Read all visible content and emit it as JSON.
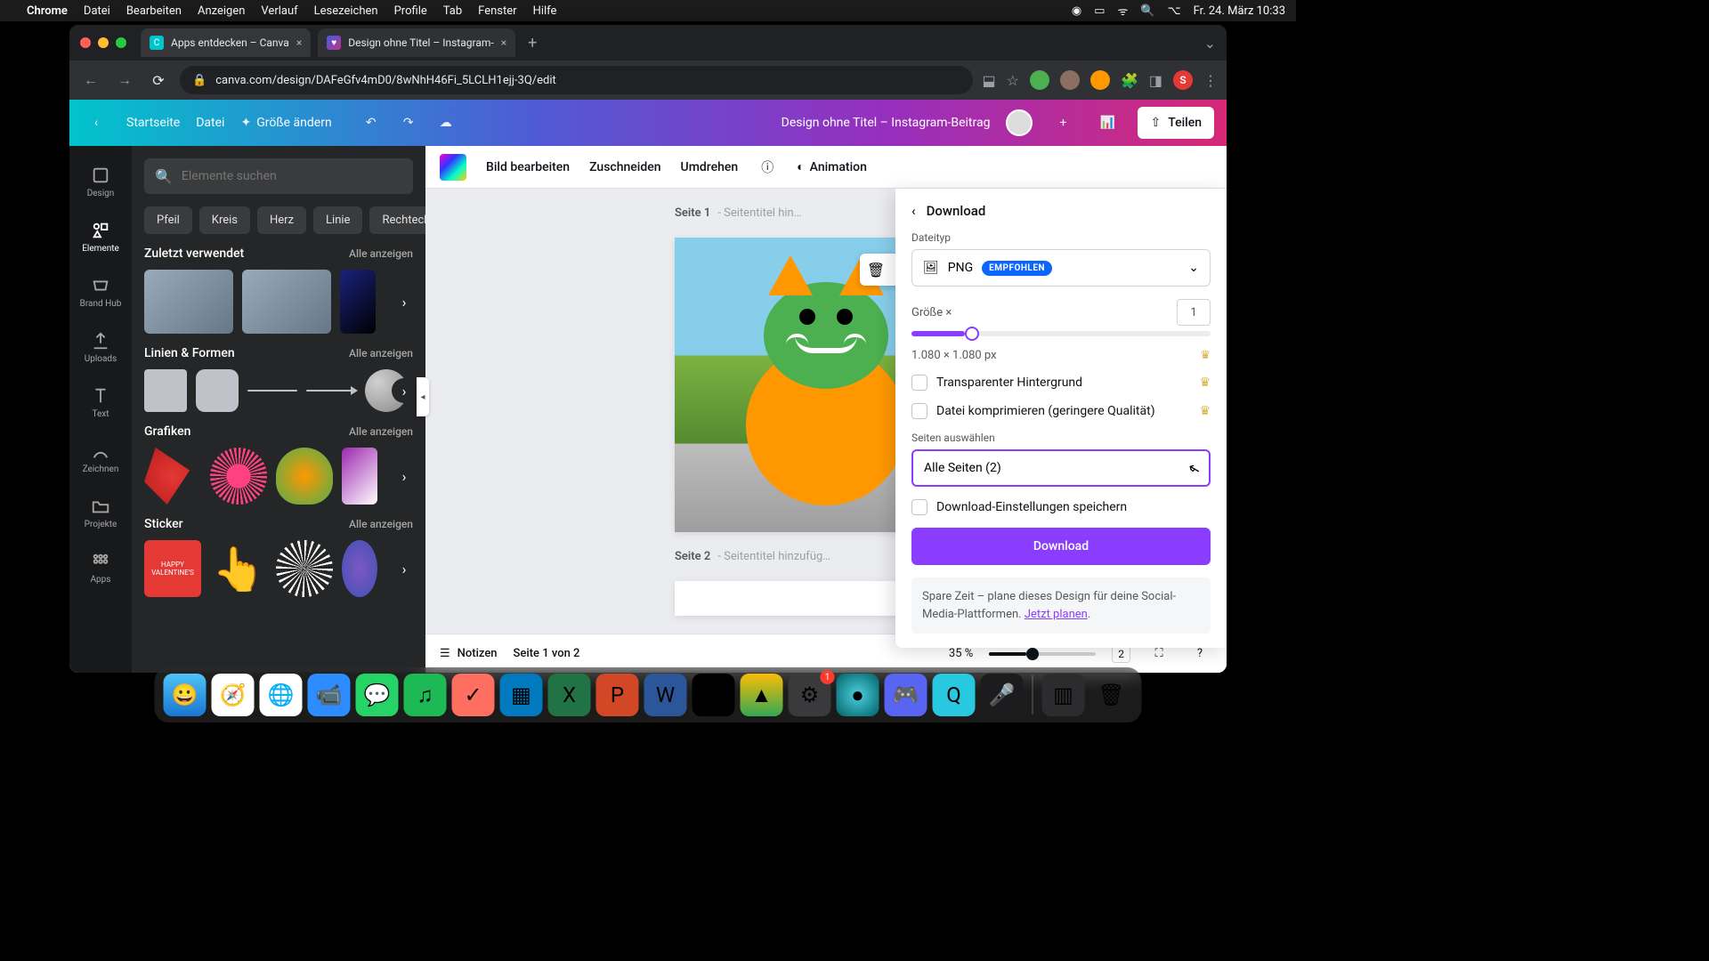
{
  "menubar": {
    "app": "Chrome",
    "items": [
      "Datei",
      "Bearbeiten",
      "Anzeigen",
      "Verlauf",
      "Lesezeichen",
      "Profile",
      "Tab",
      "Fenster",
      "Hilfe"
    ],
    "datetime": "Fr. 24. März  10:33"
  },
  "tabs": {
    "t1": "Apps entdecken – Canva",
    "t2": "Design ohne Titel – Instagram-"
  },
  "url": "canva.com/design/DAFeGfv4mD0/8wNhH46Fi_5LCLH1ejj-3Q/edit",
  "canva_top": {
    "home": "Startseite",
    "file": "Datei",
    "resize": "Größe ändern",
    "docname": "Design ohne Titel – Instagram-Beitrag",
    "share": "Teilen"
  },
  "rail": {
    "design": "Design",
    "elements": "Elemente",
    "brandhub": "Brand Hub",
    "uploads": "Uploads",
    "text": "Text",
    "draw": "Zeichnen",
    "projects": "Projekte",
    "apps": "Apps"
  },
  "panel": {
    "search_placeholder": "Elemente suchen",
    "chips": {
      "c1": "Pfeil",
      "c2": "Kreis",
      "c3": "Herz",
      "c4": "Linie",
      "c5": "Rechteck"
    },
    "s_recent": "Zuletzt verwendet",
    "s_lines": "Linien & Formen",
    "s_graphics": "Grafiken",
    "s_sticker": "Sticker",
    "see_all": "Alle anzeigen"
  },
  "context": {
    "edit_image": "Bild bearbeiten",
    "crop": "Zuschneiden",
    "flip": "Umdrehen",
    "animation": "Animation"
  },
  "pages": {
    "p1_prefix": "Seite 1",
    "p1_rest": " - Seitentitel hin…",
    "p2_prefix": "Seite 2",
    "p2_rest": " - Seitentitel hinzufüg…"
  },
  "download": {
    "title": "Download",
    "filetype_label": "Dateityp",
    "png": "PNG",
    "recommended": "EMPFOHLEN",
    "size_label": "Größe ×",
    "size_value": "1",
    "dimensions": "1.080 × 1.080 px",
    "transparent": "Transparenter Hintergrund",
    "compress": "Datei komprimieren (geringere Qualität)",
    "pages_label": "Seiten auswählen",
    "all_pages": "Alle Seiten (2)",
    "save_settings": "Download-Einstellungen speichern",
    "button": "Download",
    "promo1": "Spare Zeit – plane dieses Design für deine Social-Media-Plattformen. ",
    "promo_link": "Jetzt planen"
  },
  "bottom": {
    "notes": "Notizen",
    "page_info": "Seite 1 von 2",
    "zoom": "35 %",
    "page_count": "2"
  }
}
